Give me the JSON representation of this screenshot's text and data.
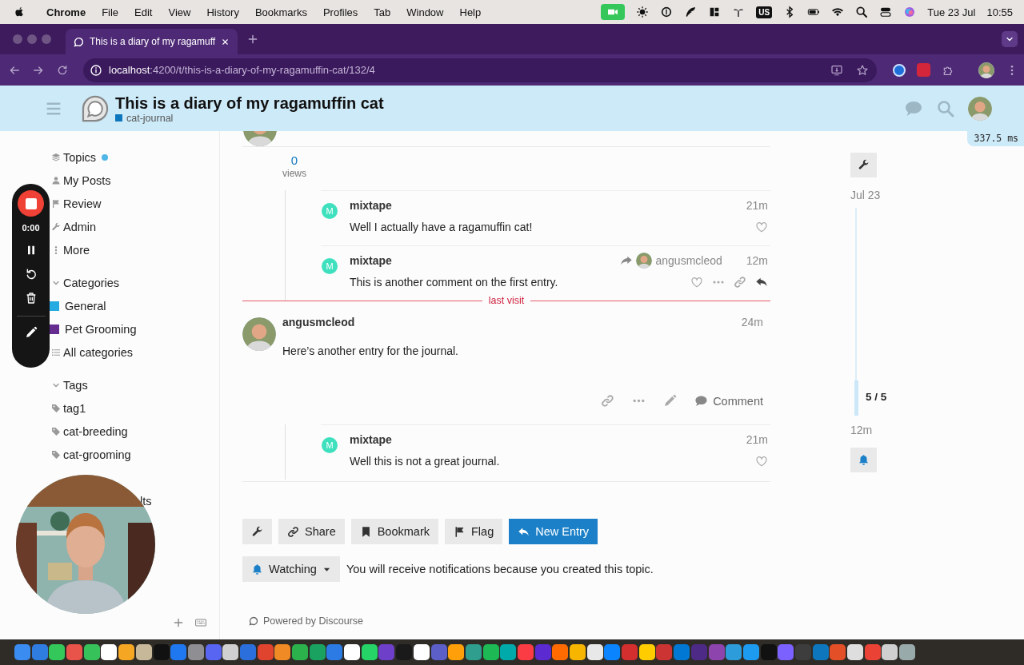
{
  "menu_bar": {
    "app": "Chrome",
    "menus": [
      "File",
      "Edit",
      "View",
      "History",
      "Bookmarks",
      "Profiles",
      "Tab",
      "Window",
      "Help"
    ],
    "keyboard": "US",
    "date": "Tue 23 Jul",
    "time": "10:55"
  },
  "browser": {
    "tab": {
      "title": "This is a diary of my ragamuff",
      "selected": true
    },
    "address": {
      "host": "localhost",
      "path": ":4200/t/this-is-a-diary-of-my-ragamuffin-cat/132/4"
    }
  },
  "header": {
    "title": "This is a diary of my ragamuffin cat",
    "category": {
      "name": "cat-journal",
      "color": "#0e76bd"
    }
  },
  "timing": "337.5 ms",
  "sidebar": {
    "items": [
      {
        "label": "Topics",
        "unread": true
      },
      {
        "label": "My Posts",
        "unread": false
      },
      {
        "label": "Review",
        "unread": false
      },
      {
        "label": "Admin",
        "unread": false
      },
      {
        "label": "More",
        "unread": false
      }
    ],
    "sections": [
      {
        "title": "Categories",
        "expanded": true,
        "items": [
          {
            "label": "General",
            "kind": "category",
            "color": "#25aae1"
          },
          {
            "label": "Pet Grooming",
            "kind": "category",
            "color": "#652d90"
          },
          {
            "label": "All categories",
            "kind": "all"
          }
        ]
      },
      {
        "title": "Tags",
        "expanded": true,
        "items": [
          {
            "label": "tag1",
            "kind": "tag"
          },
          {
            "label": "cat-breeding",
            "kind": "tag"
          },
          {
            "label": "cat-grooming",
            "kind": "tag"
          },
          {
            "label": "lts",
            "kind": "hidden_start"
          }
        ]
      }
    ]
  },
  "recorder": {
    "elapsed": "0:00"
  },
  "stream": [
    {
      "kind": "post_edge"
    },
    {
      "kind": "views",
      "count": "0",
      "label": "views"
    },
    {
      "kind": "comments",
      "items": [
        {
          "avatar_letter": "M",
          "user": "mixtape",
          "time": "21m",
          "text": "Well I actually have a ragamuffin cat!",
          "liked": false,
          "show_actions": false
        },
        {
          "avatar_letter": "M",
          "user": "mixtape",
          "reply_to": "angusmcleod",
          "time": "12m",
          "text": "This is another comment on the first entry.",
          "liked": false,
          "show_actions": true
        }
      ]
    },
    {
      "kind": "divider",
      "label": "last visit"
    },
    {
      "kind": "entry",
      "user": "angusmcleod",
      "time": "24m",
      "text": "Here’s another entry for the journal.",
      "comment_label": "Comment"
    },
    {
      "kind": "comments",
      "items": [
        {
          "avatar_letter": "M",
          "user": "mixtape",
          "time": "21m",
          "text": "Well this is not a great journal.",
          "liked": false,
          "show_actions": false
        }
      ]
    }
  ],
  "buttons": [
    {
      "kind": "admin"
    },
    {
      "kind": "share",
      "label": "Share"
    },
    {
      "kind": "bookmark",
      "label": "Bookmark"
    },
    {
      "kind": "flag",
      "label": "Flag"
    },
    {
      "kind": "reply",
      "label": "New Entry",
      "primary": true
    }
  ],
  "notifications": {
    "level": "Watching",
    "text": "You will receive notifications because you created this topic."
  },
  "timeline": {
    "start": "Jul 23",
    "position": "5 / 5",
    "end": "12m",
    "level": 1
  },
  "footer": "Powered by Discourse"
}
